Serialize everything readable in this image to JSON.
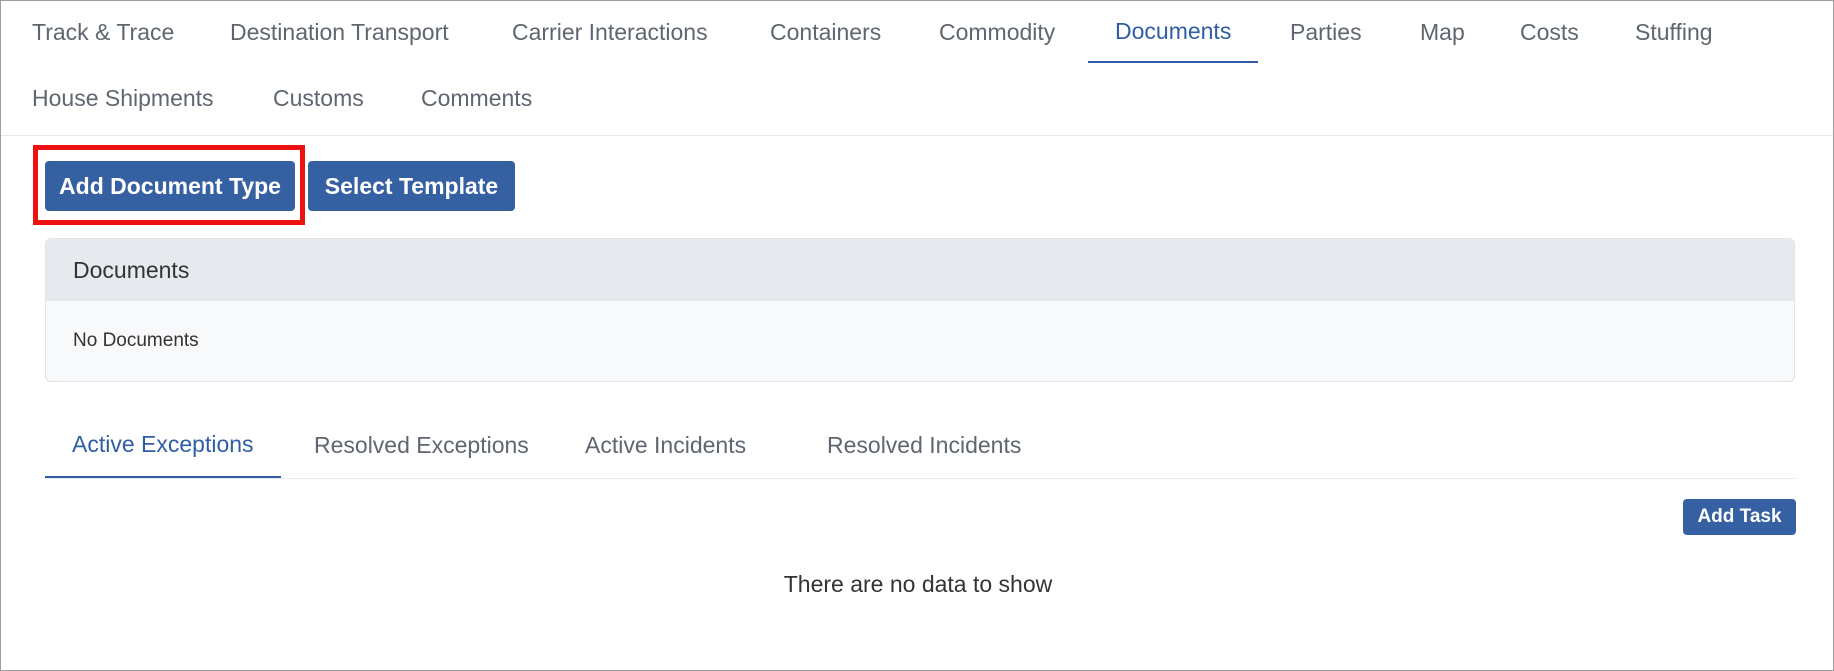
{
  "top_tabs": [
    {
      "label": "Track & Trace"
    },
    {
      "label": "Destination Transport"
    },
    {
      "label": "Carrier Interactions"
    },
    {
      "label": "Containers"
    },
    {
      "label": "Commodity"
    },
    {
      "label": "Documents"
    },
    {
      "label": "Parties"
    },
    {
      "label": "Map"
    },
    {
      "label": "Costs"
    },
    {
      "label": "Stuffing"
    },
    {
      "label": "House Shipments"
    },
    {
      "label": "Customs"
    },
    {
      "label": "Comments"
    }
  ],
  "active_top_tab": "Documents",
  "actions": {
    "add_document_type": "Add Document Type",
    "select_template": "Select Template"
  },
  "documents_panel": {
    "title": "Documents",
    "empty_text": "No Documents"
  },
  "bottom_tabs": [
    {
      "label": "Active Exceptions"
    },
    {
      "label": "Resolved Exceptions"
    },
    {
      "label": "Active Incidents"
    },
    {
      "label": "Resolved Incidents"
    }
  ],
  "active_bottom_tab": "Active Exceptions",
  "add_task_label": "Add Task",
  "empty_message": "There are no data to show",
  "colors": {
    "accent": "#2f5ea6",
    "button": "#3561a3",
    "highlight": "#ee1111"
  }
}
